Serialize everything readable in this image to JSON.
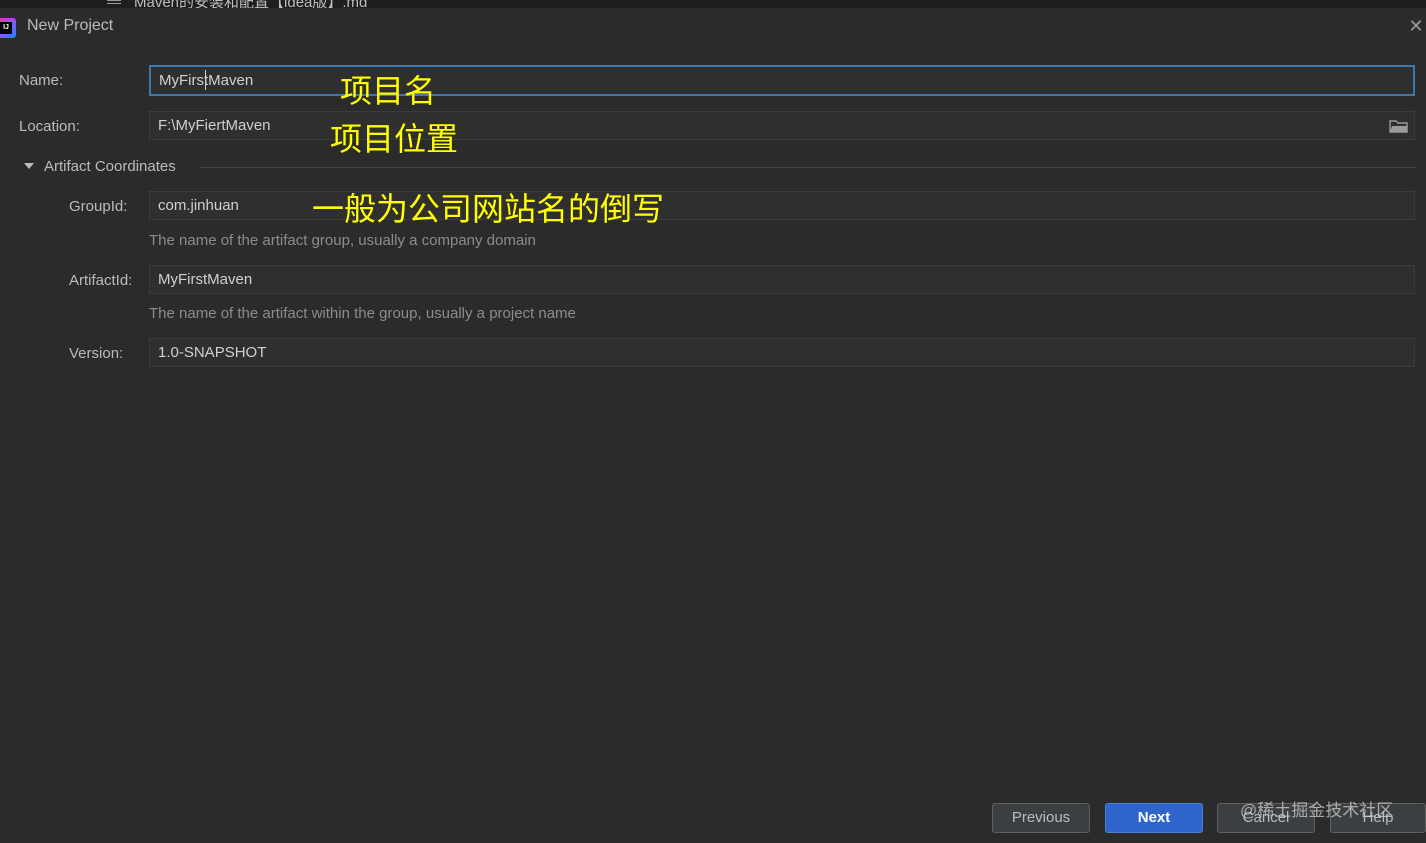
{
  "background_window": {
    "title": "Maven的安装和配置【idea版】.md"
  },
  "dialog": {
    "title": "New Project",
    "app_icon": "intellij-idea-icon",
    "close_icon": "close-icon"
  },
  "form": {
    "name": {
      "label": "Name:",
      "value": "MyFirstMaven"
    },
    "location": {
      "label": "Location:",
      "value": "F:\\MyFiertMaven",
      "icon": "folder-icon"
    },
    "section": {
      "label": "Artifact Coordinates",
      "icon": "triangle-down-icon"
    },
    "group_id": {
      "label": "GroupId:",
      "value": "com.jinhuan",
      "hint": "The name of the artifact group, usually a company domain"
    },
    "artifact_id": {
      "label": "ArtifactId:",
      "value": "MyFirstMaven",
      "hint": "The name of the artifact within the group, usually a project name"
    },
    "version": {
      "label": "Version:",
      "value": "1.0-SNAPSHOT"
    }
  },
  "annotations": {
    "name": "项目名",
    "location": "项目位置",
    "group_id": "一般为公司网站名的倒写"
  },
  "buttons": {
    "previous": "Previous",
    "next": "Next",
    "cancel": "Cancel",
    "help": "Help"
  },
  "watermark": "@稀土掘金技术社区",
  "colors": {
    "background": "#2b2b2b",
    "accent_focus": "#3d78a8",
    "primary_button": "#2f65ca",
    "annotation": "#ffff00"
  }
}
